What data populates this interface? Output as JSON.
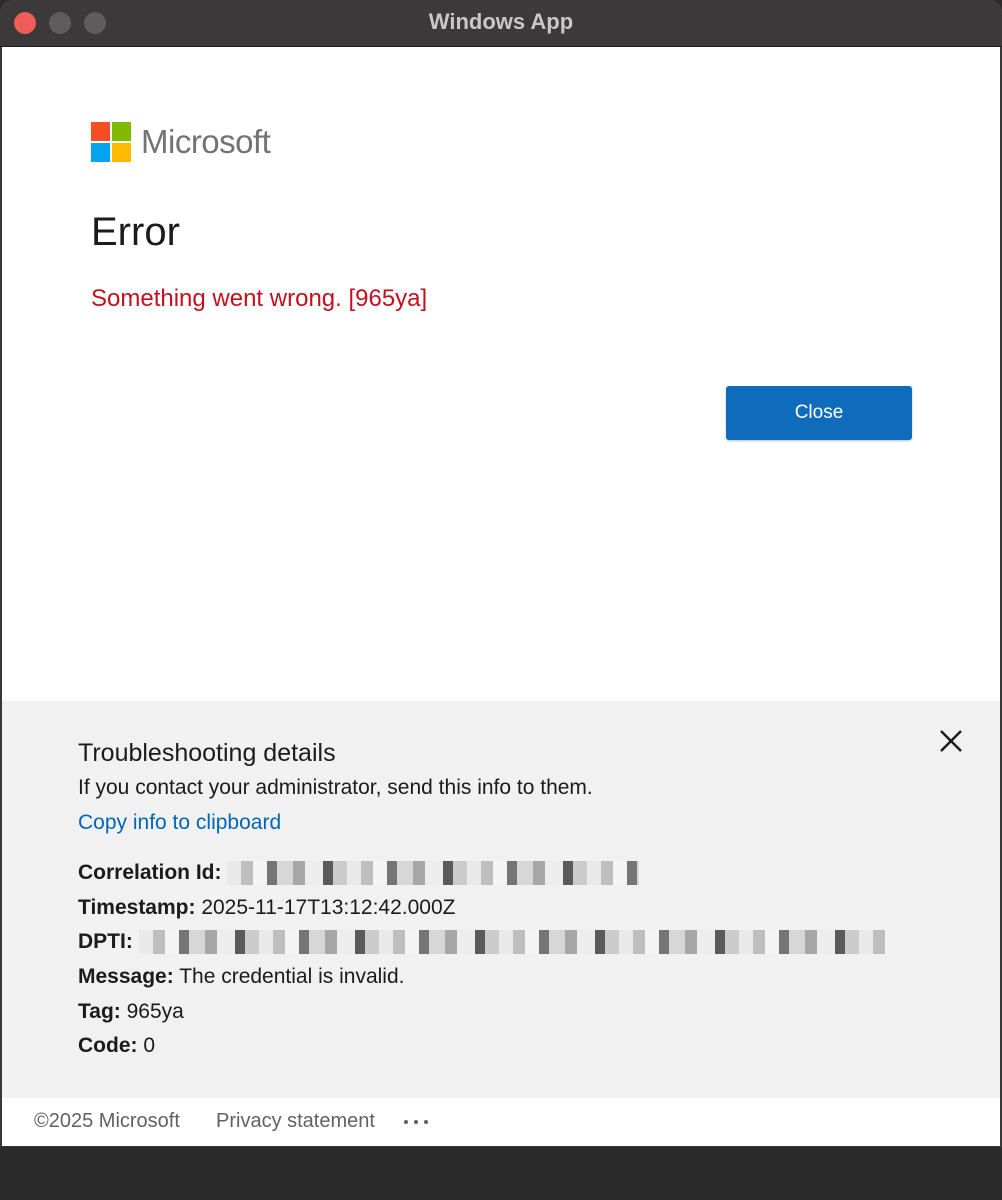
{
  "window": {
    "title": "Windows App"
  },
  "brand": {
    "name": "Microsoft",
    "logo_colors": [
      "#f25022",
      "#7fba00",
      "#00a4ef",
      "#ffb900"
    ]
  },
  "error": {
    "title": "Error",
    "message": "Something went wrong. [965ya]",
    "message_color": "#c50f1f"
  },
  "actions": {
    "close_label": "Close",
    "accent": "#0f6cbd"
  },
  "troubleshooting": {
    "title": "Troubleshooting details",
    "subtitle": "If you contact your administrator, send this info to them.",
    "copy_link": "Copy info to clipboard",
    "details": {
      "correlation_label": "Correlation Id:",
      "timestamp_label": "Timestamp:",
      "timestamp_value": "2025-11-17T13:12:42.000Z",
      "dpti_label": "DPTI:",
      "message_label": "Message:",
      "message_value": "The credential is invalid.",
      "tag_label": "Tag:",
      "tag_value": "965ya",
      "code_label": "Code:",
      "code_value": "0"
    }
  },
  "footer": {
    "copyright": "©2025 Microsoft",
    "privacy": "Privacy statement"
  }
}
